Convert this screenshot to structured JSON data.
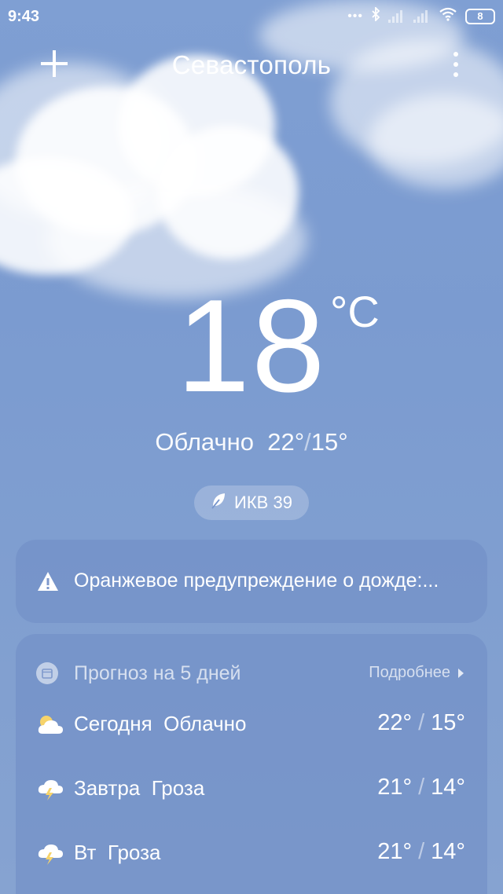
{
  "status_bar": {
    "time": "9:43",
    "battery": "8",
    "icons": [
      "dots-icon",
      "bluetooth-icon",
      "signal-icon",
      "signal-icon",
      "wifi-icon",
      "battery-icon"
    ]
  },
  "header": {
    "city": "Севастополь"
  },
  "current": {
    "temperature": "18",
    "unit": "°C",
    "condition": "Облачно",
    "high": "22°",
    "low": "15°",
    "separator": "/"
  },
  "aqi": {
    "label": "ИКВ 39"
  },
  "alert": {
    "text": "Оранжевое предупреждение о дожде:..."
  },
  "forecast": {
    "title": "Прогноз на 5 дней",
    "more_label": "Подробнее",
    "rows": [
      {
        "day": "Сегодня",
        "condition": "Облачно",
        "high": "22°",
        "low": "15°",
        "icon": "cloudy-icon"
      },
      {
        "day": "Завтра",
        "condition": "Гроза",
        "high": "21°",
        "low": "14°",
        "icon": "thunderstorm-icon"
      },
      {
        "day": "Вт",
        "condition": "Гроза",
        "high": "21°",
        "low": "14°",
        "icon": "thunderstorm-icon"
      }
    ]
  },
  "colors": {
    "sky": "#7f9fd3",
    "card": "#708cc4",
    "sun": "#f6d36a"
  }
}
